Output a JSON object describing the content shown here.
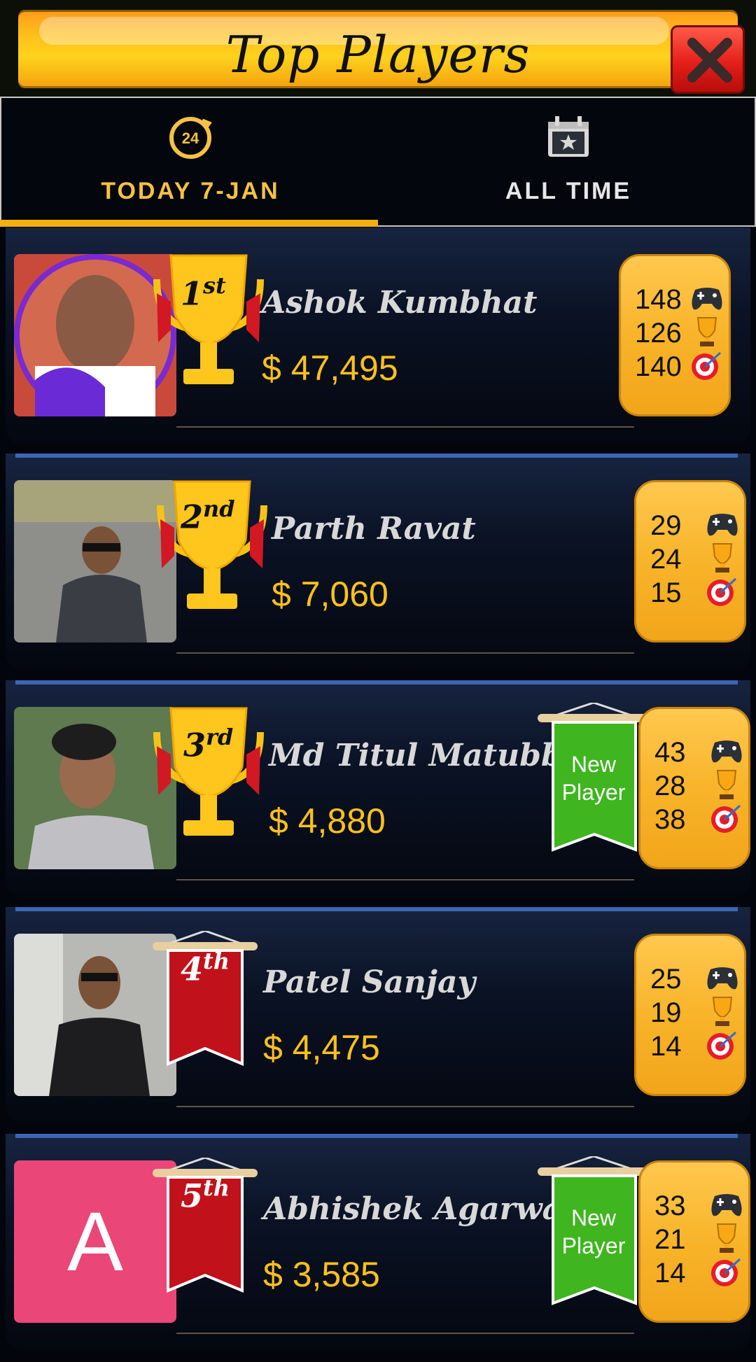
{
  "header": {
    "title": "Top Players"
  },
  "tabs": [
    {
      "label": "TODAY 7-JAN",
      "active": true
    },
    {
      "label": "ALL TIME",
      "active": false
    }
  ],
  "players": [
    {
      "rank_num": "1",
      "rank_suffix": "st",
      "name": "Ashok Kumbhat",
      "money": "$ 47,495",
      "games": "148",
      "trophies": "126",
      "targets": "140",
      "new_player": false,
      "badge": "trophy"
    },
    {
      "rank_num": "2",
      "rank_suffix": "nd",
      "name": "Parth Ravat",
      "money": "$ 7,060",
      "games": "29",
      "trophies": "24",
      "targets": "15",
      "new_player": false,
      "badge": "trophy"
    },
    {
      "rank_num": "3",
      "rank_suffix": "rd",
      "name": "Md Titul Matubber",
      "money": "$ 4,880",
      "games": "43",
      "trophies": "28",
      "targets": "38",
      "new_player": true,
      "new_label_1": "New",
      "new_label_2": "Player",
      "badge": "trophy"
    },
    {
      "rank_num": "4",
      "rank_suffix": "th",
      "name": "Patel Sanjay",
      "money": "$ 4,475",
      "games": "25",
      "trophies": "19",
      "targets": "14",
      "new_player": false,
      "badge": "banner"
    },
    {
      "rank_num": "5",
      "rank_suffix": "th",
      "name": "Abhishek Agarwal",
      "money": "$ 3,585",
      "games": "33",
      "trophies": "21",
      "targets": "14",
      "new_player": true,
      "new_label_1": "New",
      "new_label_2": "Player",
      "badge": "banner",
      "avatar_letter": "A"
    }
  ],
  "colors": {
    "gold": "#ffc11d",
    "tab_active": "#f6c242",
    "row_line": "#3b66b5",
    "avatar_pink": "#eb4678",
    "new_green": "#39b51d"
  }
}
